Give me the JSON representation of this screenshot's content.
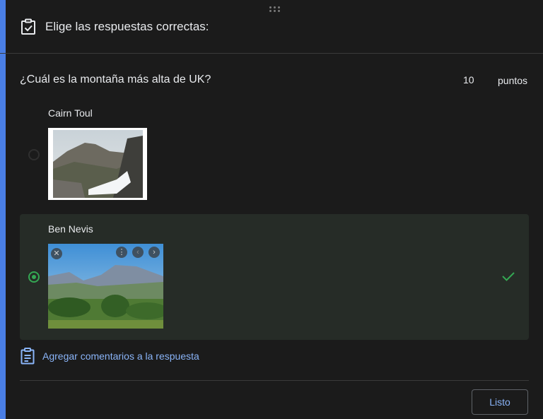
{
  "header": {
    "title": "Elige las respuestas correctas:",
    "icon": "checklist-icon"
  },
  "question": {
    "text": "¿Cuál es la montaña más alta de UK?",
    "points_value": "10",
    "points_label": "puntos"
  },
  "options": [
    {
      "label": "Cairn Toul",
      "selected": false
    },
    {
      "label": "Ben Nevis",
      "selected": true,
      "correct": true
    }
  ],
  "feedback": {
    "label": "Agregar comentarios a la respuesta",
    "icon": "clipboard-icon"
  },
  "footer": {
    "done_label": "Listo"
  },
  "colors": {
    "accent": "#4a7fe6",
    "correct": "#34a853",
    "link": "#8ab4f8",
    "selected_bg": "#262c27"
  }
}
